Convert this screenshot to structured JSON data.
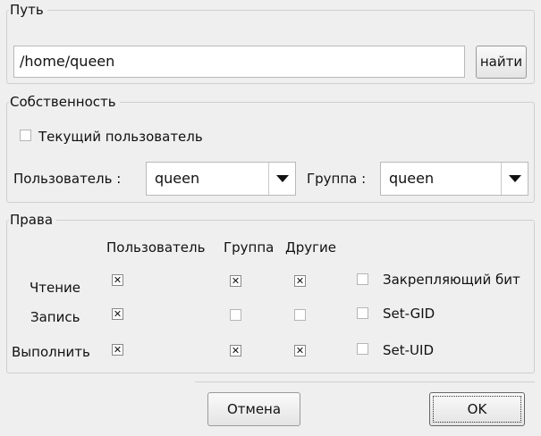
{
  "path": {
    "title": "Путь",
    "value": "/home/queen",
    "find_button": "найти"
  },
  "ownership": {
    "title": "Собственность",
    "current_user_label": "Текущий пользователь",
    "current_user_checked": false,
    "user_label": "Пользователь :",
    "user_value": "queen",
    "group_label": "Группа :",
    "group_value": "queen"
  },
  "rights": {
    "title": "Права",
    "columns": [
      "Пользователь",
      "Группа",
      "Другие"
    ],
    "rows": [
      {
        "label": "Чтение",
        "user": true,
        "group": true,
        "other": true,
        "flag_label": "Закрепляющий бит",
        "flag": false
      },
      {
        "label": "Запись",
        "user": true,
        "group": false,
        "other": false,
        "flag_label": "Set-GID",
        "flag": false
      },
      {
        "label": "Выполнить",
        "user": true,
        "group": true,
        "other": true,
        "flag_label": "Set-UID",
        "flag": false
      }
    ]
  },
  "buttons": {
    "cancel": "Отмена",
    "ok": "OK"
  },
  "check_mark": "✕"
}
